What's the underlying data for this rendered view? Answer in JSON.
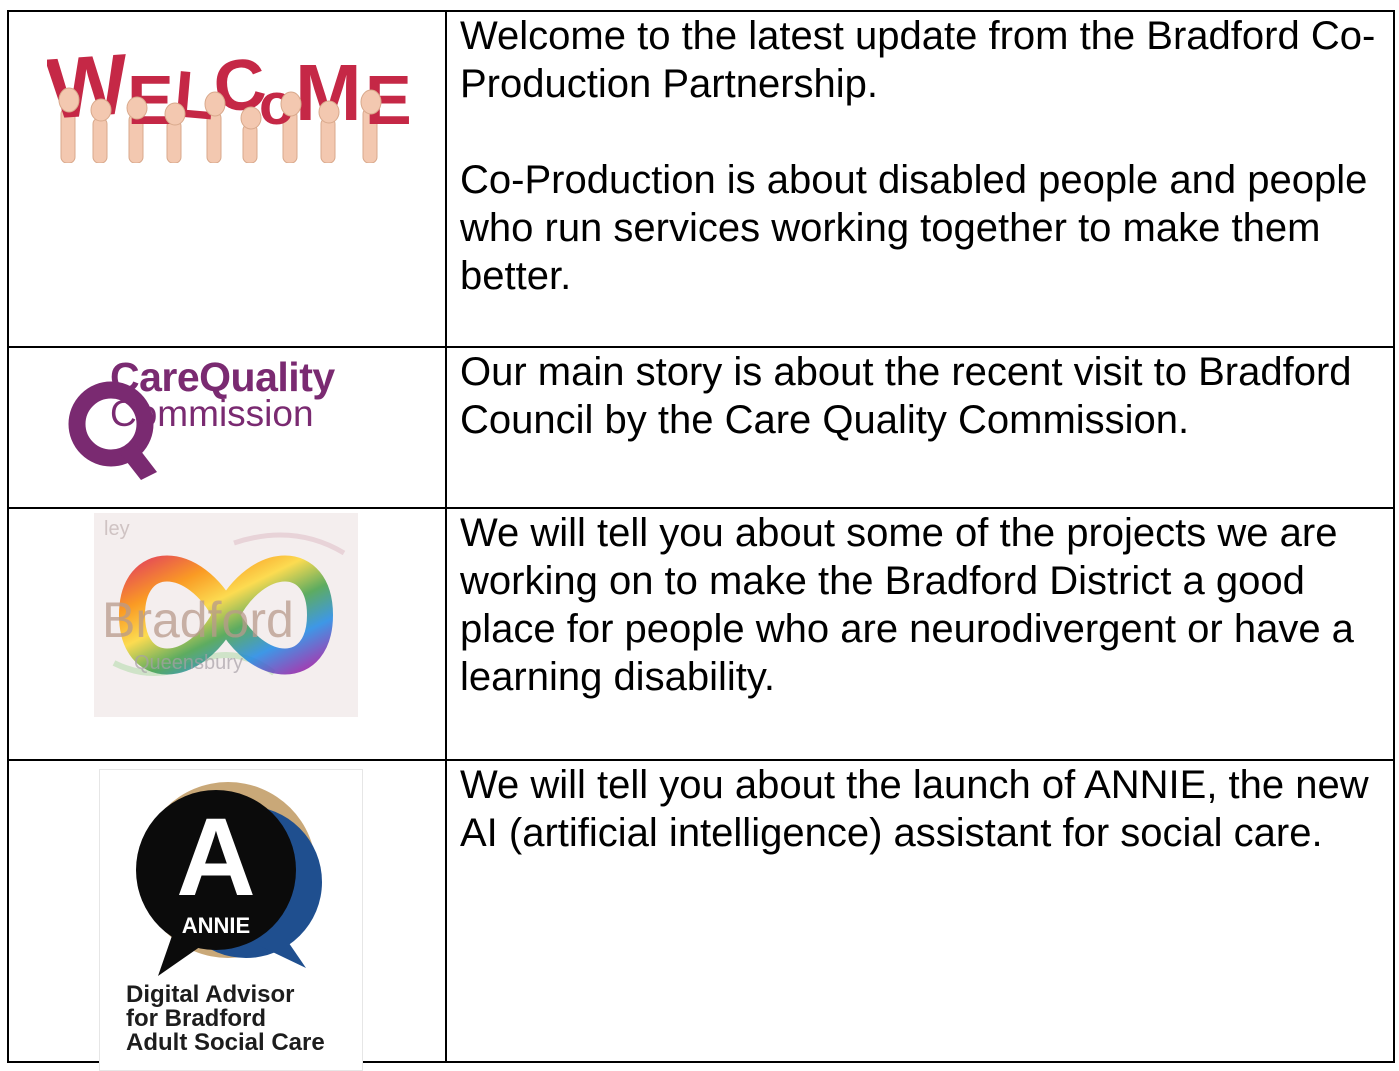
{
  "rows": [
    {
      "image": {
        "icon": "welcome-sign-image",
        "letters": "WELCOME"
      },
      "paragraphs": [
        "Welcome to the latest update from the Bradford Co-Production Partnership.",
        "Co-Production is about disabled people and people who run services working together to make them better."
      ]
    },
    {
      "image": {
        "icon": "cqc-logo",
        "line1": "CareQuality",
        "line2": "Commission",
        "color": "#7a2a71"
      },
      "paragraphs": [
        "Our main story is about the recent visit to Bradford Council by the Care Quality Commission."
      ]
    },
    {
      "image": {
        "icon": "bradford-infinity-image",
        "word": "Bradford",
        "sub": "Queensbury",
        "corner": "ley"
      },
      "paragraphs": [
        "We will tell you about some of the projects we are working on to make the Bradford District a good place for people who are neurodivergent or have a learning disability."
      ]
    },
    {
      "image": {
        "icon": "annie-logo",
        "letter": "A",
        "name": "ANNIE",
        "caption_lines": [
          "Digital Advisor",
          "for Bradford",
          "Adult Social Care"
        ]
      },
      "paragraphs": [
        "We will tell you about the launch of ANNIE, the new AI (artificial intelligence) assistant for social care."
      ]
    }
  ]
}
